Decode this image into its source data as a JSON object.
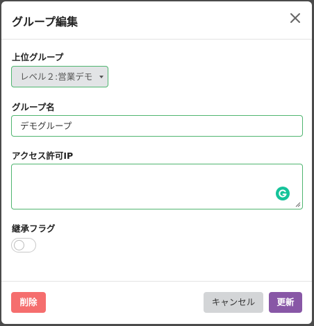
{
  "modal": {
    "title": "グループ編集",
    "close_icon": "close-icon"
  },
  "parent_group": {
    "label": "上位グループ",
    "selected": "レベル２:営業デモ"
  },
  "group_name": {
    "label": "グループ名",
    "value": "デモグループ"
  },
  "access_ip": {
    "label": "アクセス許可IP",
    "value": ""
  },
  "inherit_flag": {
    "label": "継承フラグ",
    "enabled": false
  },
  "footer": {
    "delete_label": "削除",
    "cancel_label": "キャンセル",
    "update_label": "更新"
  },
  "colors": {
    "accent_border": "#4fb56f",
    "delete": "#f56e6e",
    "cancel": "#d3d5d7",
    "update": "#8857a6",
    "grammarly": "#15c39a"
  }
}
